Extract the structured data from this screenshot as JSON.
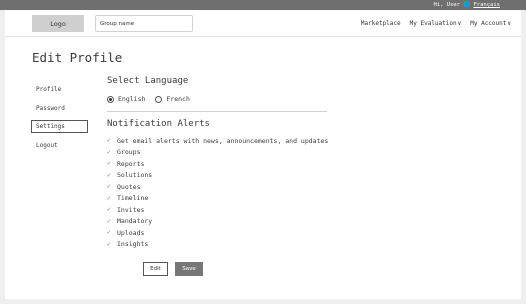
{
  "topbar": {
    "greeting": "Hi, User",
    "language_link": "Français",
    "globe_icon": "globe-icon"
  },
  "header": {
    "logo": "Logo",
    "group_input_placeholder": "Group name",
    "nav": {
      "marketplace": "Marketplace",
      "my_evaluation": "My Evaluation",
      "my_account": "My Account"
    }
  },
  "page": {
    "title": "Edit Profile"
  },
  "sidebar": {
    "items": [
      {
        "label": "Profile",
        "active": false
      },
      {
        "label": "Password",
        "active": false
      },
      {
        "label": "Settings",
        "active": true
      },
      {
        "label": "Logout",
        "active": false
      }
    ]
  },
  "language": {
    "title": "Select Language",
    "options": [
      {
        "label": "English",
        "selected": true
      },
      {
        "label": "French",
        "selected": false
      }
    ]
  },
  "notifications": {
    "title": "Notification Alerts",
    "items": [
      "Get email alerts with news, announcements, and updates",
      "Groups",
      "Reports",
      "Solutions",
      "Quotes",
      "Timeline",
      "Invites",
      "Mandatory",
      "Uploads",
      "Insights"
    ]
  },
  "actions": {
    "edit_label": "Edit",
    "save_label": "Save"
  },
  "colors": {
    "topbar": "#6f6f6f",
    "save_button": "#777777",
    "logo_bg": "#cfcfcf"
  }
}
